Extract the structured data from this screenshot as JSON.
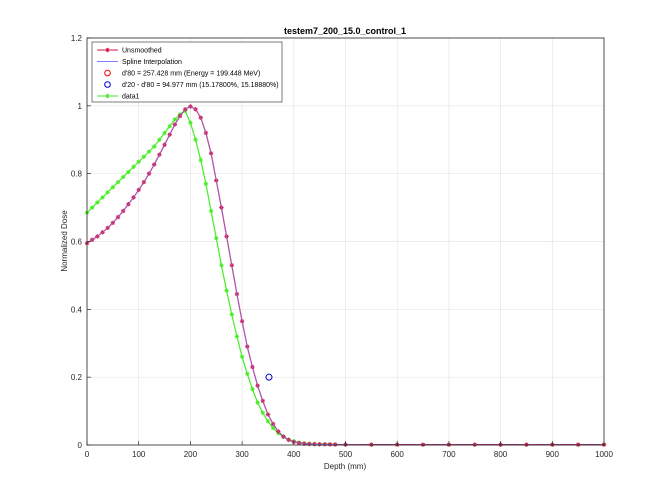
{
  "chart_data": {
    "type": "line",
    "title": "testem7_200_15.0_control_1",
    "xlabel": "Depth (mm)",
    "ylabel": "Normalized Dose",
    "xlim": [
      0,
      1000
    ],
    "ylim": [
      0,
      1.2
    ],
    "xticks": [
      0,
      100,
      200,
      300,
      400,
      500,
      600,
      700,
      800,
      900,
      1000
    ],
    "xtick_labels": [
      "0",
      "100",
      "200",
      "300",
      "400",
      "500",
      "600",
      "700",
      "800",
      "900",
      "1000"
    ],
    "yticks": [
      0,
      0.2,
      0.4,
      0.6,
      0.8,
      1,
      1.2
    ],
    "ytick_labels": [
      "0",
      "0.2",
      "0.4",
      "0.6",
      "0.8",
      "1",
      "1.2"
    ],
    "grid": true,
    "legend_position": "top-left",
    "colors": {
      "unsmoothed": "#d4134a",
      "spline": "#7f7fff",
      "d80": "#ff0000",
      "d20": "#0000cc",
      "data1": "#44ee22",
      "axis": "#262626",
      "grid": "#e6e6e6"
    },
    "legend": [
      {
        "label": "Unsmoothed",
        "marker": "asterisk-line",
        "color": "#d4134a"
      },
      {
        "label": "Spline Interpolation",
        "marker": "line",
        "color": "#7f7fff"
      },
      {
        "label": "d'80 = 257.428 mm (Energy = 199.448 MeV)",
        "marker": "circle",
        "color": "#ff0000"
      },
      {
        "label": "d'20 - d'80 = 94.977 mm (15.17800%, 15.18880%)",
        "marker": "circle",
        "color": "#0000cc"
      },
      {
        "label": "data1",
        "marker": "asterisk-line",
        "color": "#44ee22"
      }
    ],
    "series": [
      {
        "name": "Unsmoothed",
        "x": [
          0,
          10,
          20,
          30,
          40,
          50,
          60,
          70,
          80,
          90,
          100,
          110,
          120,
          130,
          140,
          150,
          160,
          170,
          180,
          190,
          200,
          210,
          220,
          230,
          240,
          250,
          260,
          270,
          280,
          290,
          300,
          310,
          320,
          330,
          340,
          350,
          360,
          370,
          380,
          390,
          400,
          410,
          420,
          430,
          440,
          450,
          460,
          470,
          480,
          500,
          550,
          600,
          650,
          700,
          750,
          800,
          850,
          900,
          950,
          1000
        ],
        "y": [
          0.595,
          0.605,
          0.615,
          0.627,
          0.64,
          0.655,
          0.672,
          0.69,
          0.71,
          0.73,
          0.752,
          0.775,
          0.8,
          0.827,
          0.856,
          0.885,
          0.915,
          0.945,
          0.97,
          0.99,
          0.998,
          0.99,
          0.965,
          0.92,
          0.86,
          0.78,
          0.7,
          0.615,
          0.53,
          0.445,
          0.365,
          0.29,
          0.23,
          0.175,
          0.13,
          0.09,
          0.062,
          0.04,
          0.025,
          0.015,
          0.009,
          0.006,
          0.004,
          0.003,
          0.0025,
          0.002,
          0.002,
          0.0018,
          0.0015,
          0.0012,
          0.001,
          0.001,
          0.001,
          0.001,
          0.001,
          0.001,
          0.001,
          0.001,
          0.001,
          0.001
        ]
      },
      {
        "name": "data1",
        "x": [
          0,
          10,
          20,
          30,
          40,
          50,
          60,
          70,
          80,
          90,
          100,
          110,
          120,
          130,
          140,
          150,
          160,
          170,
          180,
          190,
          200,
          210,
          220,
          230,
          240,
          250,
          260,
          270,
          280,
          290,
          300,
          310,
          320,
          330,
          340,
          350,
          360,
          370,
          380,
          390,
          400,
          410,
          420,
          430,
          440,
          450,
          460,
          470,
          480,
          500,
          550,
          600,
          650,
          700,
          750,
          800,
          850,
          900,
          950,
          1000
        ],
        "y": [
          0.685,
          0.7,
          0.715,
          0.73,
          0.745,
          0.76,
          0.775,
          0.79,
          0.805,
          0.82,
          0.835,
          0.85,
          0.865,
          0.88,
          0.9,
          0.92,
          0.94,
          0.96,
          0.975,
          0.985,
          0.95,
          0.9,
          0.84,
          0.77,
          0.69,
          0.61,
          0.53,
          0.455,
          0.385,
          0.32,
          0.26,
          0.21,
          0.165,
          0.125,
          0.095,
          0.07,
          0.05,
          0.035,
          0.024,
          0.016,
          0.011,
          0.007,
          0.005,
          0.004,
          0.003,
          0.0025,
          0.002,
          0.002,
          0.0015,
          0.0012,
          0.001,
          0.001,
          0.001,
          0.001,
          0.001,
          0.001,
          0.001,
          0.001,
          0.001,
          0.001
        ]
      }
    ],
    "markers": [
      {
        "name": "d'20",
        "x": 352,
        "y": 0.2,
        "color": "#0000cc"
      }
    ]
  }
}
